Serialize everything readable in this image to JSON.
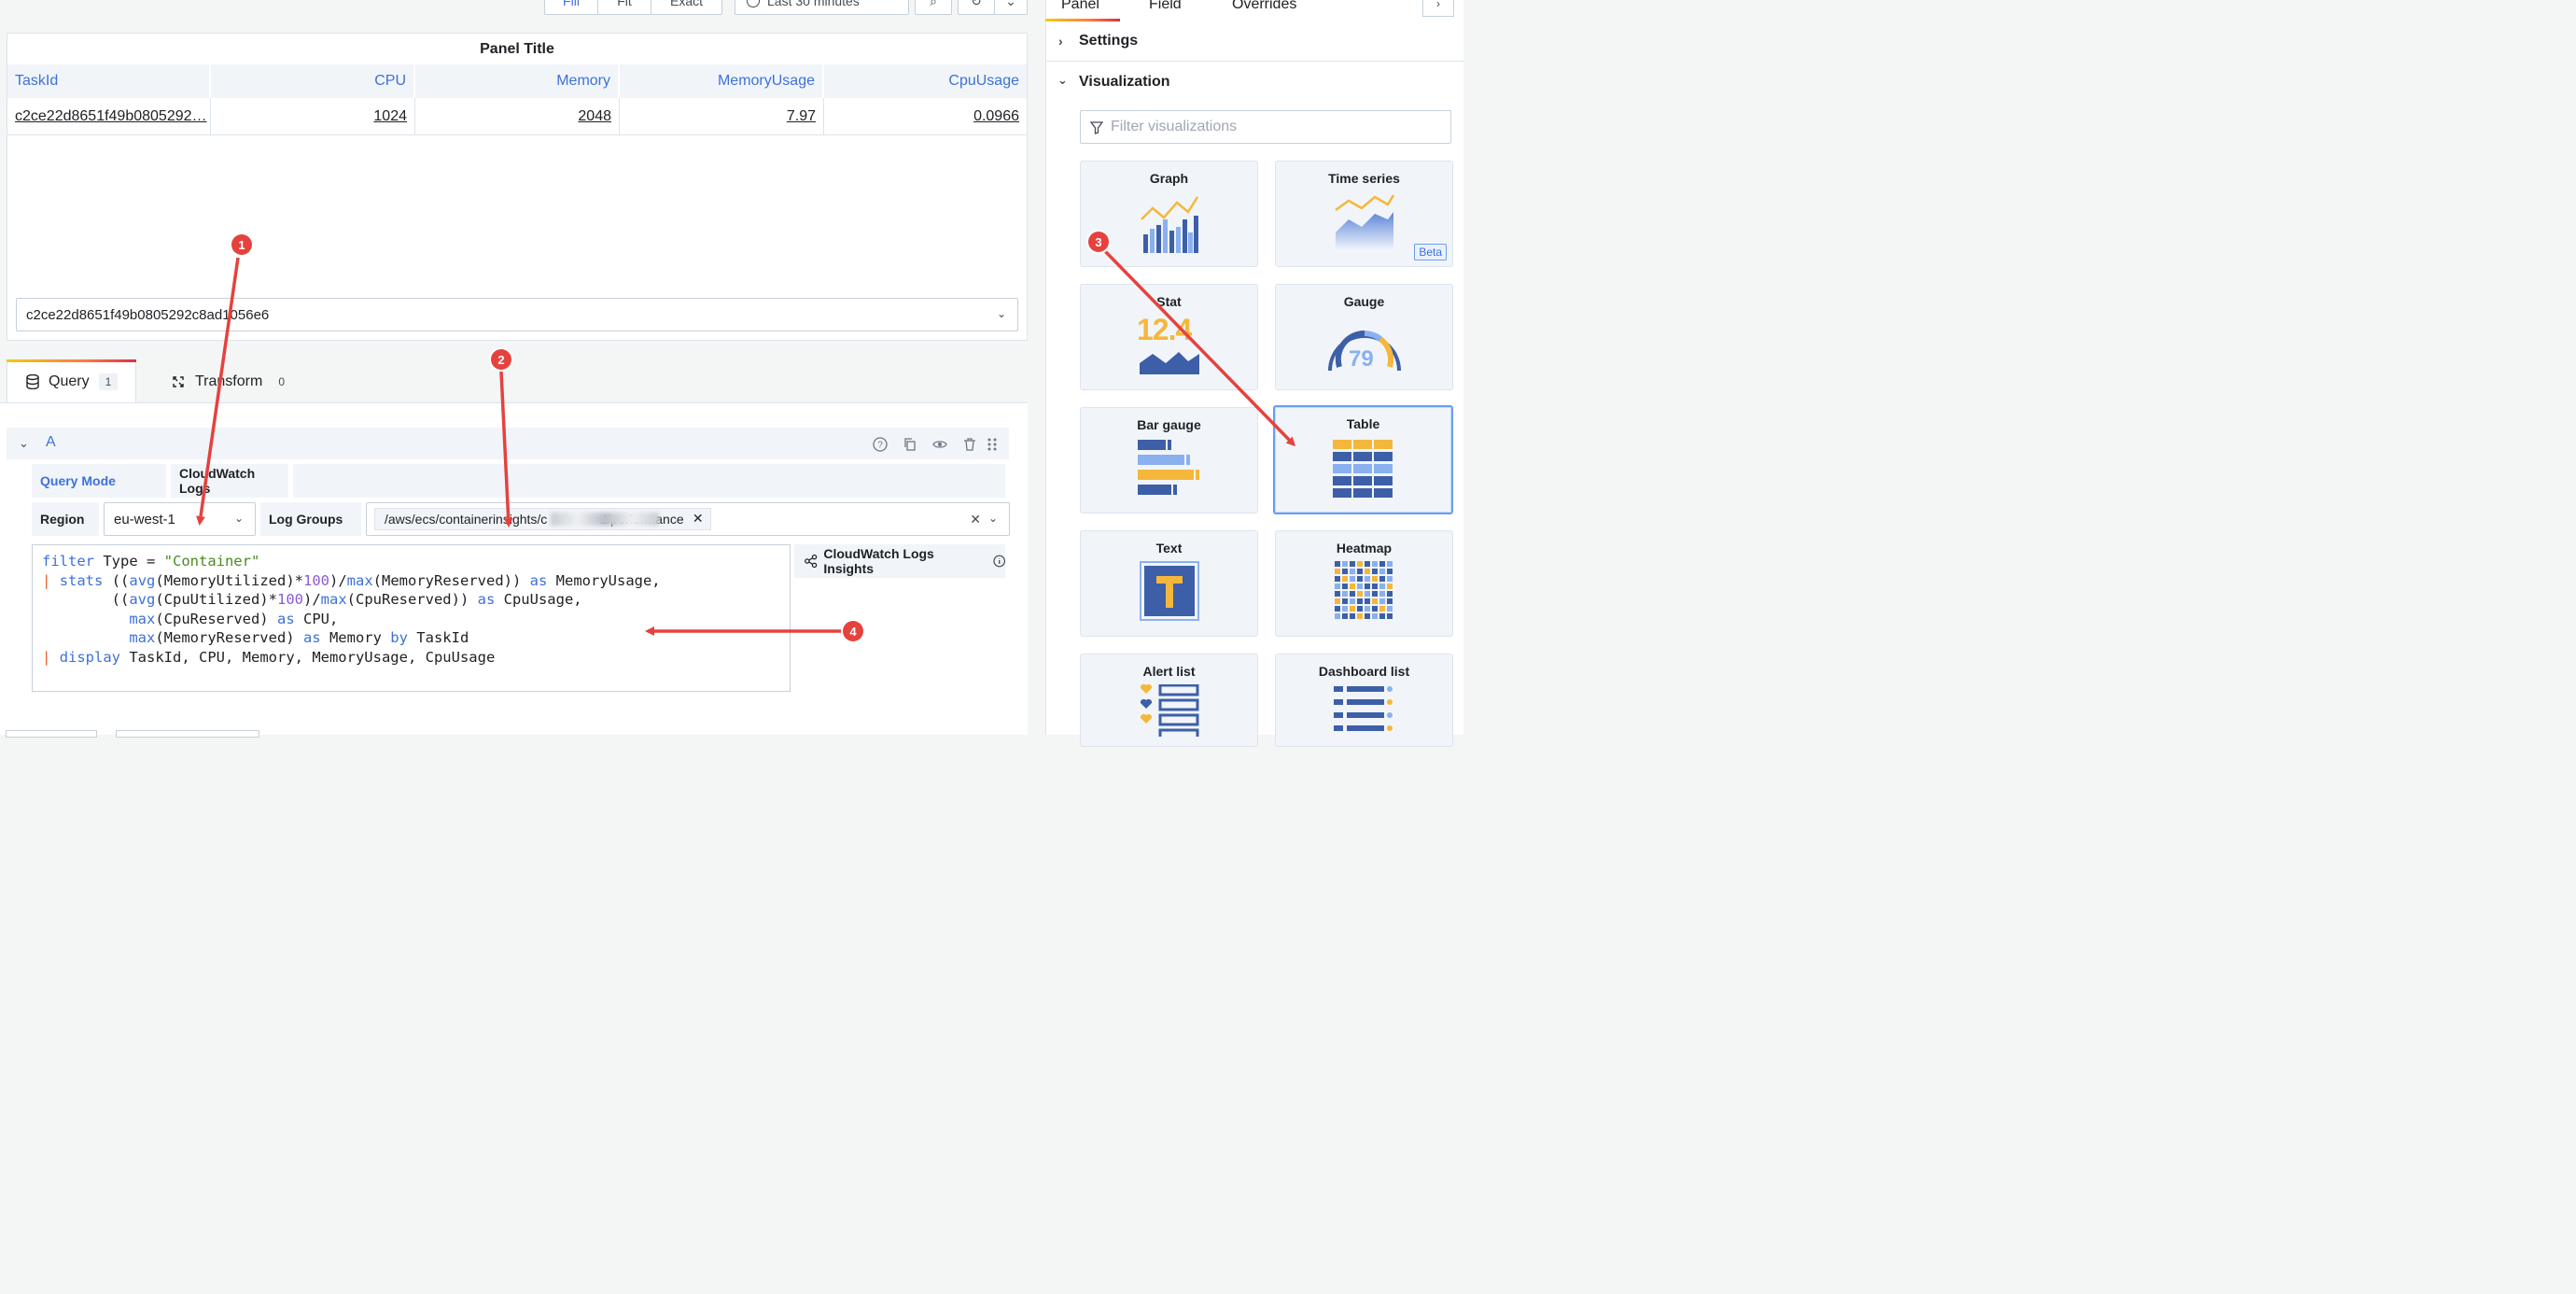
{
  "toolbar": {
    "fill_label": "Fill",
    "fit_label": "Fit",
    "exact_label": "Exact",
    "time_range": "Last 30 minutes"
  },
  "panel": {
    "title": "Panel Title",
    "columns": [
      "TaskId",
      "CPU",
      "Memory",
      "MemoryUsage",
      "CpuUsage"
    ],
    "row": [
      "c2ce22d8651f49b0805292…",
      "1024",
      "2048",
      "7.97",
      "0.0966"
    ],
    "task_select_value": "c2ce22d8651f49b0805292c8ad1056e6"
  },
  "tabs": [
    {
      "label": "Query",
      "count": "1"
    },
    {
      "label": "Transform",
      "count": "0"
    }
  ],
  "query": {
    "letter": "A",
    "mode_label": "Query Mode",
    "mode_value": "CloudWatch Logs",
    "region_label": "Region",
    "region_value": "eu-west-1",
    "log_groups_label": "Log Groups",
    "log_group_value": "/aws/ecs/containerinsights/c                    d/performance",
    "insights_button": "CloudWatch Logs Insights"
  },
  "side": {
    "tabs": [
      "Panel",
      "Field",
      "Overrides"
    ],
    "settings_label": "Settings",
    "visualization_label": "Visualization",
    "filter_placeholder": "Filter visualizations",
    "beta_label": "Beta",
    "stat_value": "12.4",
    "gauge_value": "79",
    "visualizations": [
      "Graph",
      "Time series",
      "Stat",
      "Gauge",
      "Bar gauge",
      "Table",
      "Text",
      "Heatmap",
      "Alert list",
      "Dashboard list"
    ]
  },
  "annotations": [
    "1",
    "2",
    "3",
    "4"
  ],
  "colors": {
    "accent": "#3d71d9",
    "annotation": "#e5423e",
    "viz_yellow": "#f5b73b",
    "viz_blue_dark": "#3d5fa8",
    "viz_blue_light": "#8ab0f0"
  }
}
